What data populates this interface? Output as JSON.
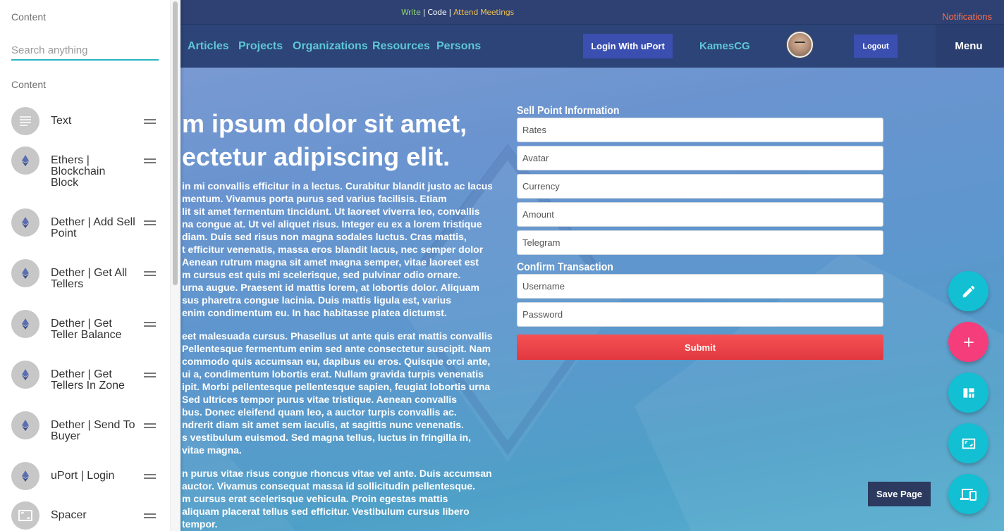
{
  "topbar": {
    "modes": {
      "write": "Write",
      "sep1": " | ",
      "code": "Code",
      "sep2": " | ",
      "meet": "Attend Meetings"
    },
    "notifications": "Notifications"
  },
  "nav": {
    "links": [
      "Articles",
      "Projects",
      "Organizations",
      "Resources",
      "Persons"
    ],
    "login_uport": "Login With uPort",
    "username": "KamesCG",
    "logout": "Logout",
    "menu": "Menu"
  },
  "hero": {
    "title_line1": "m ipsum dolor sit amet,",
    "title_line2": "ectetur adipiscing elit.",
    "paragraphs": [
      [
        "in mi convallis efficitur in a lectus. Curabitur blandit justo ac lacus",
        "mentum. Vivamus porta purus sed varius facilisis. Etiam",
        "lit sit amet fermentum tincidunt. Ut laoreet viverra leo, convallis",
        "na congue at. Ut vel aliquet risus. Integer eu ex a lorem tristique",
        " diam. Duis sed risus non magna sodales luctus. Cras mattis,",
        "t efficitur venenatis, massa eros blandit lacus, nec semper dolor",
        "Aenean rutrum magna sit amet magna semper, vitae laoreet est",
        "m cursus est quis mi scelerisque, sed pulvinar odio ornare.",
        "urna augue. Praesent id mattis lorem, at lobortis dolor. Aliquam",
        "sus pharetra congue lacinia. Duis mattis ligula est, varius",
        "enim condimentum eu. In hac habitasse platea dictumst."
      ],
      [
        "eet malesuada cursus. Phasellus ut ante quis erat mattis convallis",
        "Pellentesque fermentum enim sed ante consectetur suscipit. Nam",
        "commodo quis accumsan eu, dapibus eu eros. Quisque orci ante,",
        "ui a, condimentum lobortis erat. Nullam gravida turpis venenatis",
        "ipit. Morbi pellentesque pellentesque sapien, feugiat lobortis urna",
        "Sed ultrices tempor purus vitae tristique. Aenean convallis",
        "bus. Donec eleifend quam leo, a auctor turpis convallis ac.",
        "ndrerit diam sit amet sem iaculis, at sagittis nunc venenatis.",
        "s vestibulum euismod. Sed magna tellus, luctus in fringilla in,",
        "vitae magna."
      ],
      [
        "n purus vitae risus congue rhoncus vitae vel ante. Duis accumsan",
        "auctor. Vivamus consequat massa id sollicitudin pellentesque.",
        "m cursus erat scelerisque vehicula. Proin egestas mattis",
        " aliquam placerat tellus sed efficitur. Vestibulum cursus libero",
        " tempor."
      ]
    ]
  },
  "form": {
    "sell_heading": "Sell Point Information",
    "fields": [
      "Rates",
      "Avatar",
      "Currency",
      "Amount",
      "Telegram"
    ],
    "confirm_heading": "Confirm Transaction",
    "username_placeholder": "Username",
    "password_placeholder": "Password",
    "submit": "Submit"
  },
  "save_page": "Save Page",
  "fabs": [
    "pencil-icon",
    "plus-icon",
    "layout-icon",
    "crop-icon",
    "devices-icon"
  ],
  "sidebar": {
    "title": "Content",
    "search_placeholder": "Search anything",
    "section": "Content",
    "items": [
      {
        "label": "Text",
        "icon": "text-lines-icon"
      },
      {
        "label": "Ethers | Blockchain Block",
        "icon": "ethereum-icon"
      },
      {
        "label": "Dether | Add Sell Point",
        "icon": "ethereum-icon"
      },
      {
        "label": "Dether | Get All Tellers",
        "icon": "ethereum-icon"
      },
      {
        "label": "Dether | Get Teller Balance",
        "icon": "ethereum-icon"
      },
      {
        "label": "Dether | Get Tellers In Zone",
        "icon": "ethereum-icon"
      },
      {
        "label": "Dether | Send To Buyer",
        "icon": "ethereum-icon"
      },
      {
        "label": "uPort | Login",
        "icon": "ethereum-icon"
      },
      {
        "label": "Spacer",
        "icon": "spacer-icon"
      }
    ]
  },
  "colors": {
    "topbar": "#2e4172",
    "navbar": "#2c4478",
    "nav_link": "#5ec7d6",
    "primary_button": "#3b4fb0",
    "submit": "#e94449",
    "fab_teal": "#13bfd2",
    "fab_pink": "#f53d7b",
    "search_underline": "#29b6c6",
    "notifications": "#ff6d4a"
  }
}
